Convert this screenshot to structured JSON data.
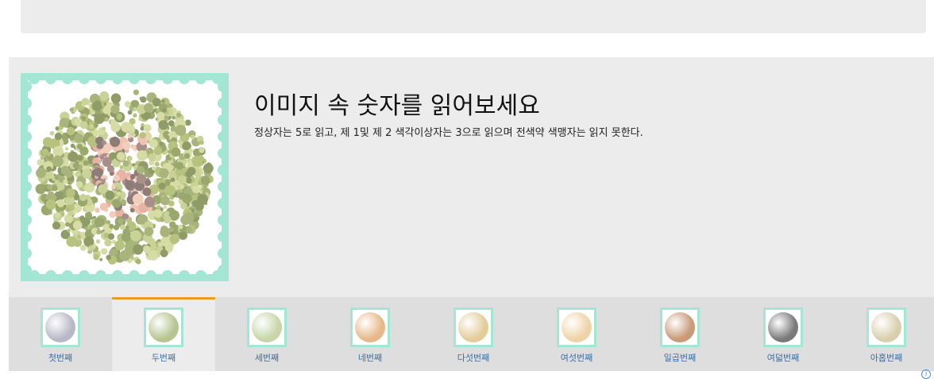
{
  "plate": {
    "title": "이미지 속 숫자를 읽어보세요",
    "description": "정상자는 5로 읽고, 제 1및 제 2 색각이상자는 3으로 읽으며 전색약 색맹자는 읽지 못한다."
  },
  "tabs": [
    {
      "label": "첫번째",
      "active": false,
      "color": "#b8b8c8"
    },
    {
      "label": "두번째",
      "active": true,
      "color": "#b7c48f"
    },
    {
      "label": "세번째",
      "active": false,
      "color": "#c7d6a8"
    },
    {
      "label": "네번째",
      "active": false,
      "color": "#e6b98a"
    },
    {
      "label": "다섯번째",
      "active": false,
      "color": "#e3cc9a"
    },
    {
      "label": "여섯번째",
      "active": false,
      "color": "#efd3a8"
    },
    {
      "label": "일곱번째",
      "active": false,
      "color": "#c89a78"
    },
    {
      "label": "여덟번째",
      "active": false,
      "color": "#7a7a7a"
    },
    {
      "label": "아홉번째",
      "active": false,
      "color": "#d8cfae"
    }
  ],
  "colors": {
    "frame": "#a3e6d4",
    "active_tab_border": "#e6a01e",
    "tab_label": "#3a6ea5"
  },
  "icons": {
    "info": "info-icon"
  }
}
